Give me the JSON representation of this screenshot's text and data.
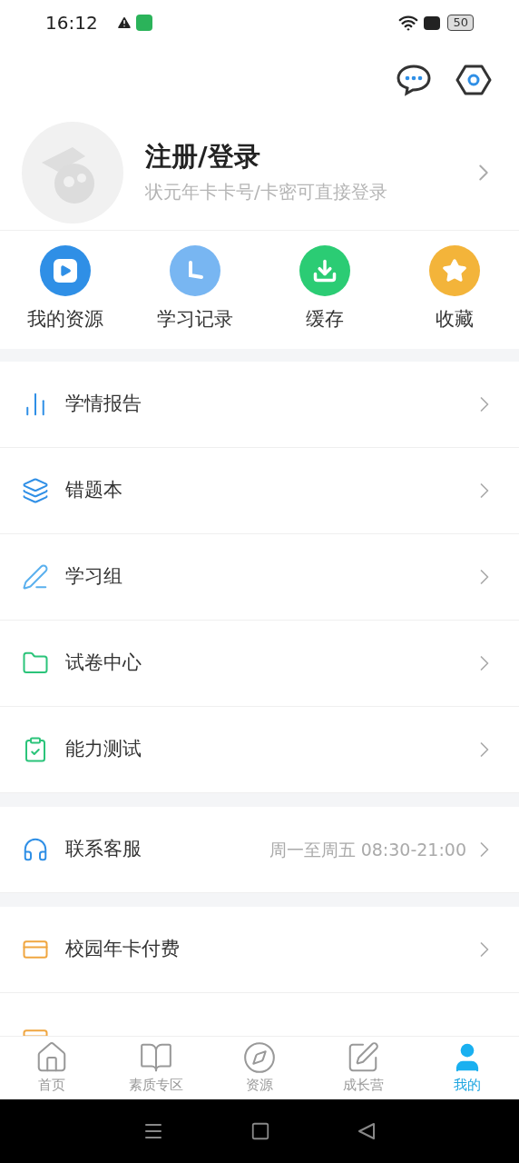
{
  "status_bar": {
    "time": "16:12",
    "battery": "50"
  },
  "profile": {
    "title": "注册/登录",
    "subtitle": "状元年卡卡号/卡密可直接登录"
  },
  "quick_actions": [
    {
      "label": "我的资源"
    },
    {
      "label": "学习记录"
    },
    {
      "label": "缓存"
    },
    {
      "label": "收藏"
    }
  ],
  "menu_groups": [
    {
      "items": [
        {
          "kind": "row",
          "label": "学情报告"
        },
        {
          "kind": "row",
          "label": "错题本"
        },
        {
          "kind": "row",
          "label": "学习组"
        },
        {
          "kind": "row",
          "label": "试卷中心"
        },
        {
          "kind": "row",
          "label": "能力测试"
        }
      ]
    },
    {
      "items": [
        {
          "kind": "row",
          "label": "联系客服",
          "hint": "周一至周五 08:30-21:00"
        }
      ]
    },
    {
      "items": [
        {
          "kind": "row",
          "label": "校园年卡付费"
        },
        {
          "kind": "cut"
        }
      ]
    }
  ],
  "bottom_nav": [
    {
      "label": "首页",
      "selected": false
    },
    {
      "label": "素质专区",
      "selected": false
    },
    {
      "label": "资源",
      "selected": false
    },
    {
      "label": "成长营",
      "selected": false
    },
    {
      "label": "我的",
      "selected": true
    }
  ]
}
